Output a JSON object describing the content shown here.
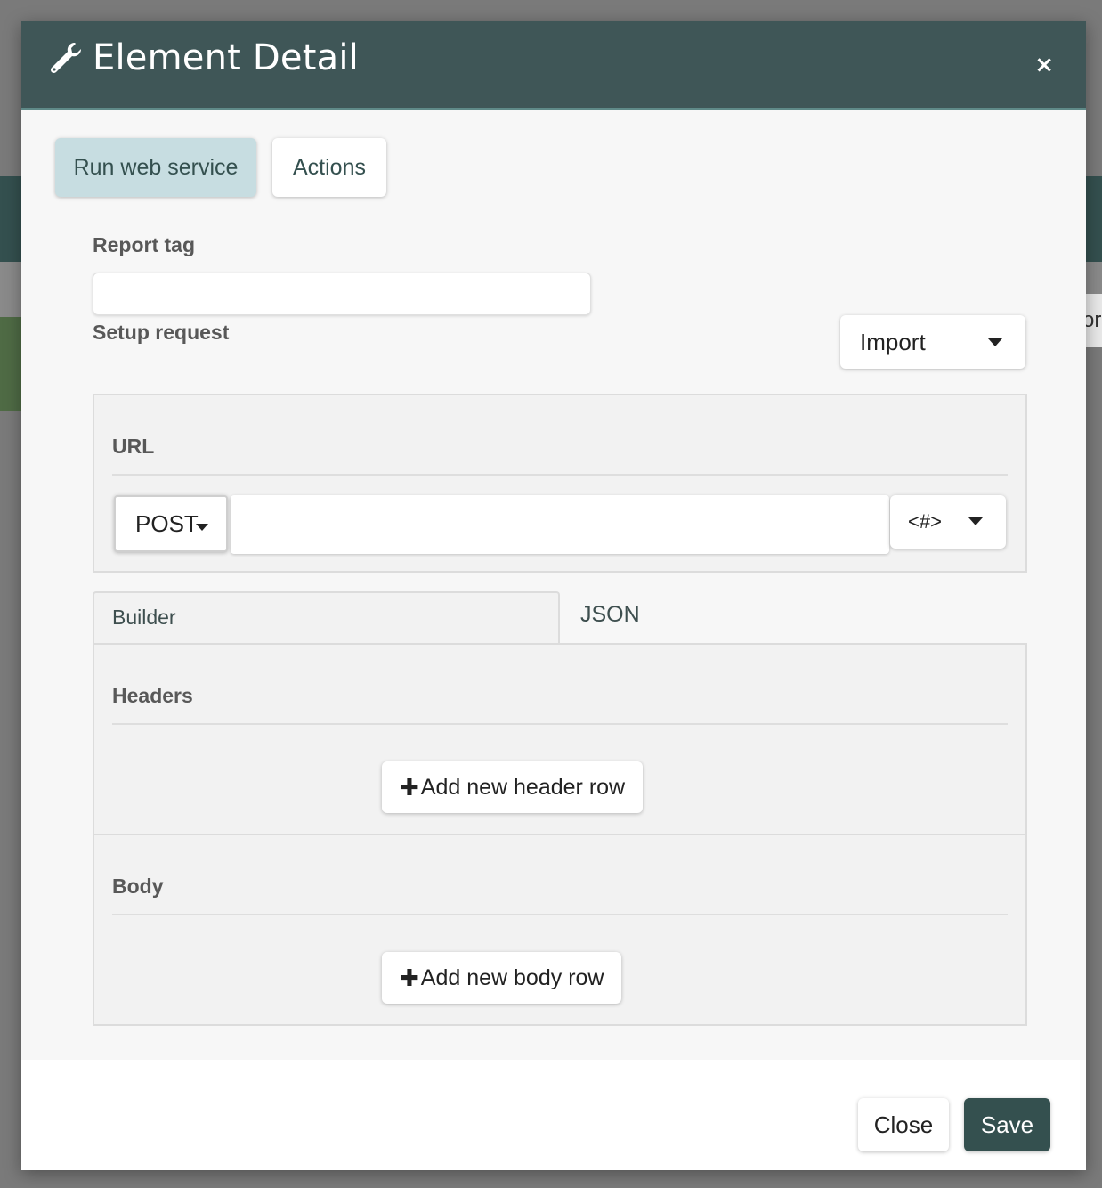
{
  "background": {
    "edge_text": "or"
  },
  "modal": {
    "title": "Element Detail",
    "title_icon": "wrench-icon",
    "close_symbol": "×"
  },
  "tabs": [
    {
      "label": "Run web service",
      "active": true
    },
    {
      "label": "Actions",
      "active": false
    }
  ],
  "report_tag": {
    "label": "Report tag",
    "value": ""
  },
  "setup": {
    "label": "Setup request",
    "import_label": "Import"
  },
  "url_section": {
    "title": "URL",
    "method": "POST",
    "url_value": "",
    "tag_button": "<#>"
  },
  "editor_tabs": {
    "builder": "Builder",
    "json": "JSON",
    "active": "Builder"
  },
  "headers": {
    "title": "Headers",
    "add_label": "Add new header row"
  },
  "body": {
    "title": "Body",
    "add_label": "Add new body row"
  },
  "footer": {
    "close_label": "Close",
    "save_label": "Save"
  },
  "colors": {
    "header_bg": "#3f5657",
    "accent": "#34504f",
    "active_tab_bg": "#c7dde1"
  }
}
